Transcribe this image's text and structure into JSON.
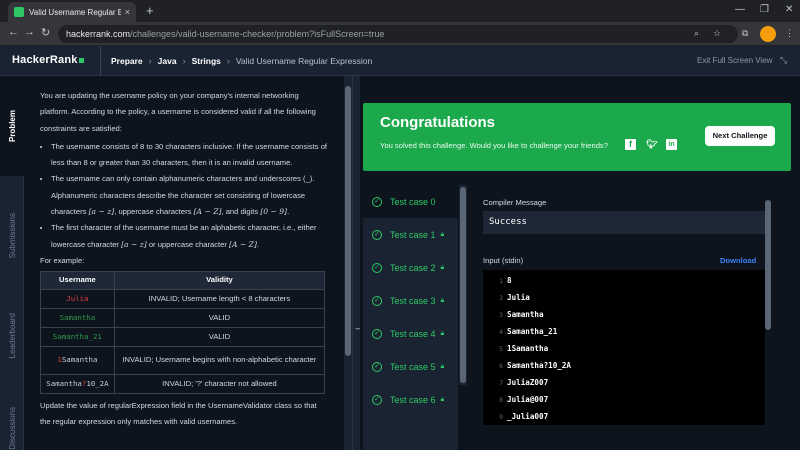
{
  "browser": {
    "tab_title": "Valid Username Regular Expressi",
    "tab_close": "×",
    "new_tab": "+",
    "url_host": "hackerrank.com",
    "url_path": "/challenges/valid-username-checker/problem?isFullScreen=true",
    "back": "←",
    "forward": "→",
    "reload": "↻"
  },
  "header": {
    "logo": "HackerRank",
    "breadcrumbs": [
      "Prepare",
      "Java",
      "Strings",
      "Valid Username Regular Expression"
    ],
    "exit_fullscreen": "Exit Full Screen View"
  },
  "side_tabs": [
    "Problem",
    "Submissions",
    "Leaderboard",
    "Discussions"
  ],
  "problem": {
    "intro": "You are updating the username policy on your company's internal networking platform. According to the policy, a username is considered valid if all the following constraints are satisfied:",
    "rule1": "The username consists of 8 to 30 characters inclusive. If the username consists of less than 8 or greater than 30 characters, then it is an invalid username.",
    "rule2a": "The username can only contain alphanumeric characters and underscores (_). Alphanumeric characters describe the character set consisting of lowercase characters ",
    "rule2_math1": "[a − z]",
    "rule2b": ", uppercase characters ",
    "rule2_math2": "[A − Z]",
    "rule2c": ", and digits ",
    "rule2_math3": "[0 − 9]",
    "rule2d": ".",
    "rule3a": "The first character of the username must be an alphabetic character, i.e., either lowercase character ",
    "rule3_math1": "[a − z]",
    "rule3b": " or uppercase character ",
    "rule3_math2": "[A − Z]",
    "rule3c": ".",
    "example_label": "For example:",
    "table_headers": [
      "Username",
      "Validity"
    ],
    "rows": [
      {
        "username": "Julia",
        "validity": "INVALID; Username length < 8 characters"
      },
      {
        "username": "Samantha",
        "validity": "VALID"
      },
      {
        "username": "Samantha_21",
        "validity": "VALID"
      },
      {
        "username_prefix": "1",
        "username_rest": "Samantha",
        "validity": "INVALID; Username begins with non-alphabetic character"
      },
      {
        "username_prefix": "Samantha",
        "username_mark": "?",
        "username_rest": "10_2A",
        "validity": "INVALID; '?' character not allowed"
      }
    ],
    "after_text": "Update the value of regularExpression field in the UsernameValidator class so that the regular expression only matches with valid usernames."
  },
  "result": {
    "title": "Congratulations",
    "message": "You solved this challenge. Would you like to challenge your friends?",
    "next_button": "Next Challenge",
    "social": [
      "f",
      "t",
      "in"
    ],
    "brand_green": "#1ba94c"
  },
  "test_cases": [
    {
      "label": "Test case 0",
      "locked": false
    },
    {
      "label": "Test case 1",
      "locked": true
    },
    {
      "label": "Test case 2",
      "locked": true
    },
    {
      "label": "Test case 3",
      "locked": true
    },
    {
      "label": "Test case 4",
      "locked": true
    },
    {
      "label": "Test case 5",
      "locked": true
    },
    {
      "label": "Test case 6",
      "locked": true
    }
  ],
  "output": {
    "compiler_label": "Compiler Message",
    "compiler_message": "Success",
    "input_label": "Input (stdin)",
    "download": "Download",
    "stdin_lines": [
      "8",
      "Julia",
      "Samantha",
      "Samantha_21",
      "1Samantha",
      "Samantha?10_2A",
      "JuliaZ007",
      "Julia@007",
      "_Julia007"
    ]
  }
}
